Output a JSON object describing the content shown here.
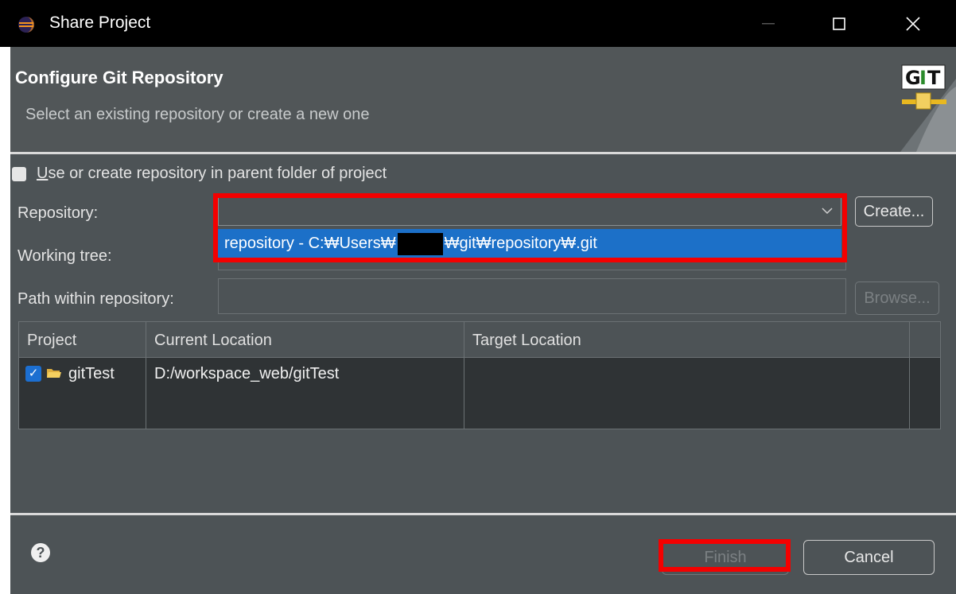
{
  "window": {
    "title": "Share Project",
    "controls": {
      "minimize": "—",
      "maximize": "☐",
      "close": "✕"
    }
  },
  "header": {
    "title": "Configure Git Repository",
    "subtitle": "Select an existing repository or create a new one",
    "logo_text": "GIT"
  },
  "options": {
    "parent_folder_checkbox": {
      "mnemonic": "U",
      "label_rest": "se or create repository in parent folder of project",
      "checked": false
    }
  },
  "repository": {
    "label": "Repository:",
    "value": "",
    "dropdown_option_prefix": "repository - C:₩Users₩",
    "dropdown_option_suffix": "₩git₩repository₩.git",
    "create_button": "Create..."
  },
  "working_tree": {
    "label": "Working tree:",
    "value": ""
  },
  "path_within_repository": {
    "label": "Path within repository:",
    "value": "",
    "browse_button": "Browse..."
  },
  "table": {
    "columns": [
      "Project",
      "Current Location",
      "Target Location"
    ],
    "rows": [
      {
        "checked": true,
        "project": "gitTest",
        "current_location": "D:/workspace_web/gitTest",
        "target_location": ""
      }
    ]
  },
  "footer": {
    "help_icon": "?",
    "finish_button": "Finish",
    "cancel_button": "Cancel"
  },
  "colors": {
    "panel": "#4d5356",
    "banner": "#515658",
    "selection": "#1c70c8",
    "highlight": "#f40000"
  }
}
